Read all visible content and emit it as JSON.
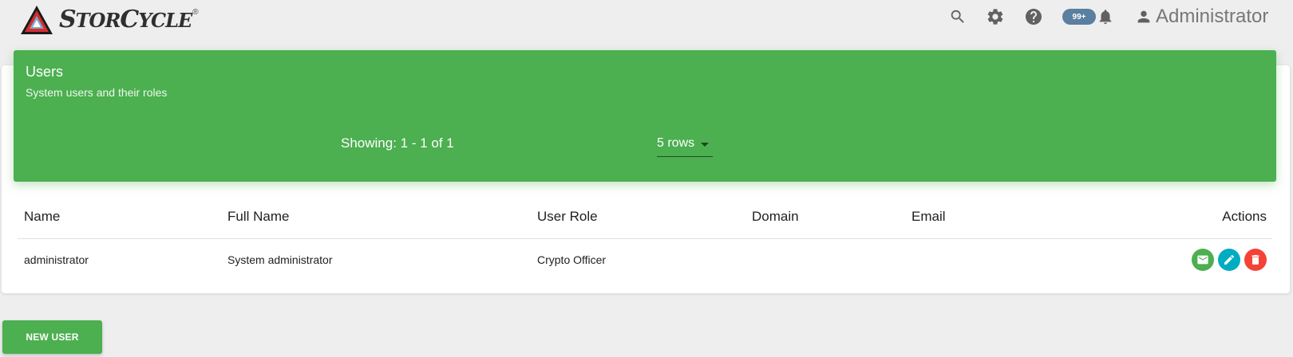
{
  "app": {
    "logo_text_big_1": "S",
    "logo_text_small_1": "TOR",
    "logo_text_big_2": "C",
    "logo_text_small_2": "YCLE",
    "logo_reg": "®"
  },
  "topbar": {
    "icons": [
      "search-icon",
      "gear-icon",
      "help-icon",
      "bell-icon",
      "person-icon"
    ],
    "notification_badge": "99+",
    "user_name": "Administrator"
  },
  "card": {
    "title": "Users",
    "subtitle": "System users and their roles",
    "showing": "Showing: 1 - 1 of 1",
    "rows_select": "5 rows"
  },
  "table": {
    "columns": [
      "Name",
      "Full Name",
      "User Role",
      "Domain",
      "Email",
      "Actions"
    ],
    "rows": [
      {
        "name": "administrator",
        "full_name": "System administrator",
        "user_role": "Crypto Officer",
        "domain": "",
        "email": ""
      }
    ],
    "row_actions": [
      "email-icon",
      "edit-icon",
      "delete-icon"
    ]
  },
  "new_user_button": "NEW USER",
  "colors": {
    "primary_green": "#4caf50",
    "edit_blue": "#00acc1",
    "delete_red": "#f44336",
    "badge": "#5a7fa0"
  }
}
